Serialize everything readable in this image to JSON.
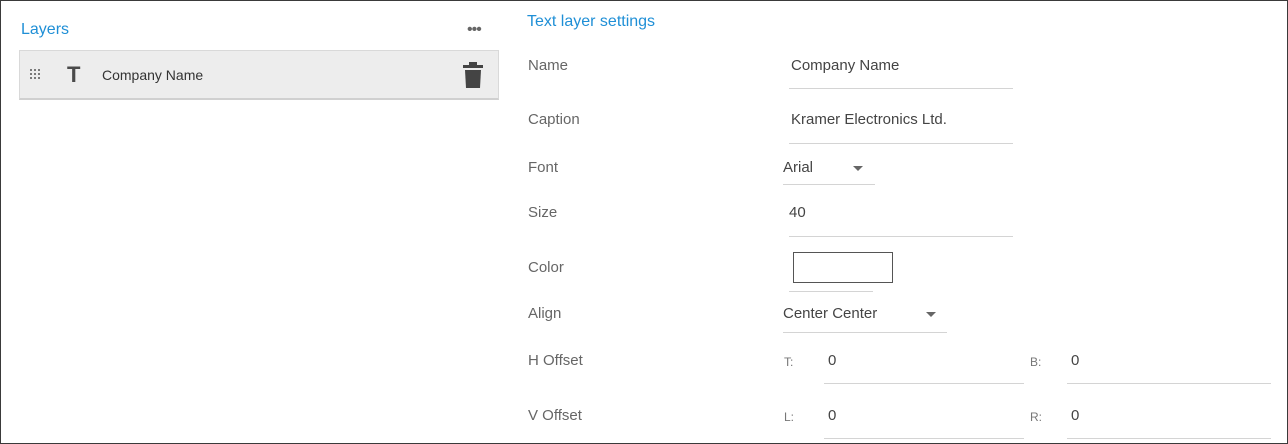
{
  "layers": {
    "title": "Layers",
    "more_icon": "more-horizontal-icon",
    "items": [
      {
        "name": "Company Name",
        "type_icon": "text-type-icon",
        "drag_icon": "drag-handle-icon",
        "delete_icon": "trash-icon"
      }
    ]
  },
  "settings": {
    "title": "Text layer settings",
    "name": {
      "label": "Name",
      "value": "Company Name"
    },
    "caption": {
      "label": "Caption",
      "value": "Kramer Electronics Ltd."
    },
    "font": {
      "label": "Font",
      "value": "Arial"
    },
    "size": {
      "label": "Size",
      "value": "40"
    },
    "color": {
      "label": "Color",
      "value": "#ffffff"
    },
    "align": {
      "label": "Align",
      "value": "Center Center"
    },
    "h_offset": {
      "label": "H Offset",
      "t_label": "T:",
      "t_value": "0",
      "b_label": "B:",
      "b_value": "0"
    },
    "v_offset": {
      "label": "V Offset",
      "l_label": "L:",
      "l_value": "0",
      "r_label": "R:",
      "r_value": "0"
    }
  },
  "colors": {
    "accent": "#1f8fd6",
    "row_bg": "#ededed"
  }
}
